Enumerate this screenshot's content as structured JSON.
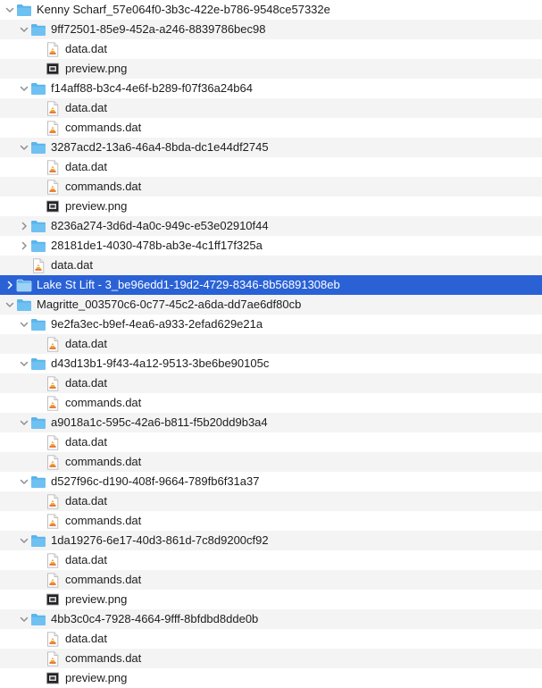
{
  "colors": {
    "selection": "#2a62d6",
    "alt_row": "#f4f4f5",
    "folder": "#5ab4ec",
    "text": "#1d1d1f",
    "disclosure": "#8e8e93"
  },
  "rows": [
    {
      "label": "Kenny Scharf_57e064f0-3b3c-422e-b786-9548ce57332e",
      "type": "folder",
      "level": 0,
      "expanded": true
    },
    {
      "label": "9ff72501-85e9-452a-a246-8839786bec98",
      "type": "folder",
      "level": 1,
      "expanded": true
    },
    {
      "label": "data.dat",
      "type": "dat",
      "level": 2
    },
    {
      "label": "preview.png",
      "type": "png",
      "level": 2
    },
    {
      "label": "f14aff88-b3c4-4e6f-b289-f07f36a24b64",
      "type": "folder",
      "level": 1,
      "expanded": true
    },
    {
      "label": "data.dat",
      "type": "dat",
      "level": 2
    },
    {
      "label": "commands.dat",
      "type": "dat",
      "level": 2
    },
    {
      "label": "3287acd2-13a6-46a4-8bda-dc1e44df2745",
      "type": "folder",
      "level": 1,
      "expanded": true
    },
    {
      "label": "data.dat",
      "type": "dat",
      "level": 2
    },
    {
      "label": "commands.dat",
      "type": "dat",
      "level": 2
    },
    {
      "label": "preview.png",
      "type": "png",
      "level": 2
    },
    {
      "label": "8236a274-3d6d-4a0c-949c-e53e02910f44",
      "type": "folder",
      "level": 1,
      "expanded": false
    },
    {
      "label": "28181de1-4030-478b-ab3e-4c1ff17f325a",
      "type": "folder",
      "level": 1,
      "expanded": false
    },
    {
      "label": "data.dat",
      "type": "dat",
      "level": 1
    },
    {
      "label": "Lake St Lift - 3_be96edd1-19d2-4729-8346-8b56891308eb",
      "type": "folder",
      "level": 0,
      "expanded": false,
      "selected": true
    },
    {
      "label": "Magritte_003570c6-0c77-45c2-a6da-dd7ae6df80cb",
      "type": "folder",
      "level": 0,
      "expanded": true
    },
    {
      "label": "9e2fa3ec-b9ef-4ea6-a933-2efad629e21a",
      "type": "folder",
      "level": 1,
      "expanded": true
    },
    {
      "label": "data.dat",
      "type": "dat",
      "level": 2
    },
    {
      "label": "d43d13b1-9f43-4a12-9513-3be6be90105c",
      "type": "folder",
      "level": 1,
      "expanded": true
    },
    {
      "label": "data.dat",
      "type": "dat",
      "level": 2
    },
    {
      "label": "commands.dat",
      "type": "dat",
      "level": 2
    },
    {
      "label": "a9018a1c-595c-42a6-b811-f5b20dd9b3a4",
      "type": "folder",
      "level": 1,
      "expanded": true
    },
    {
      "label": "data.dat",
      "type": "dat",
      "level": 2
    },
    {
      "label": "commands.dat",
      "type": "dat",
      "level": 2
    },
    {
      "label": "d527f96c-d190-408f-9664-789fb6f31a37",
      "type": "folder",
      "level": 1,
      "expanded": true
    },
    {
      "label": "data.dat",
      "type": "dat",
      "level": 2
    },
    {
      "label": "commands.dat",
      "type": "dat",
      "level": 2
    },
    {
      "label": "1da19276-6e17-40d3-861d-7c8d9200cf92",
      "type": "folder",
      "level": 1,
      "expanded": true
    },
    {
      "label": "data.dat",
      "type": "dat",
      "level": 2
    },
    {
      "label": "commands.dat",
      "type": "dat",
      "level": 2
    },
    {
      "label": "preview.png",
      "type": "png",
      "level": 2
    },
    {
      "label": "4bb3c0c4-7928-4664-9fff-8bfdbd8dde0b",
      "type": "folder",
      "level": 1,
      "expanded": true
    },
    {
      "label": "data.dat",
      "type": "dat",
      "level": 2
    },
    {
      "label": "commands.dat",
      "type": "dat",
      "level": 2
    },
    {
      "label": "preview.png",
      "type": "png",
      "level": 2
    }
  ]
}
